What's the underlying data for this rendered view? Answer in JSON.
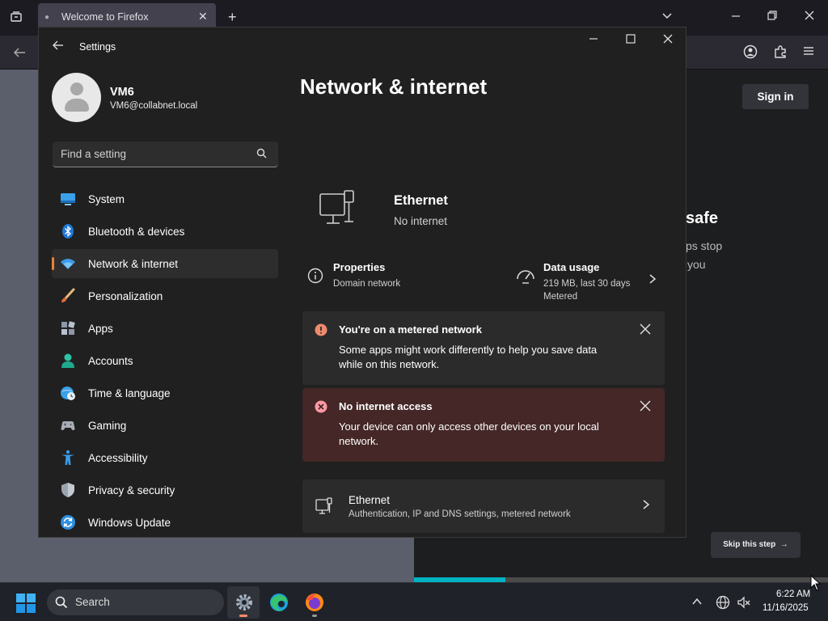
{
  "firefox": {
    "tab_title": "Welcome to Firefox",
    "signin_label": "Sign in",
    "heading_partial": "safe",
    "text_line1_partial": "ps stop",
    "text_line2_partial": "you",
    "skip_label": "Skip this step",
    "progress_fraction": 0.22
  },
  "settings": {
    "window_title": "Settings",
    "user": {
      "name": "VM6",
      "email": "VM6@collabnet.local"
    },
    "search_placeholder": "Find a setting",
    "nav": [
      {
        "label": "System",
        "icon": "system-icon",
        "active": false
      },
      {
        "label": "Bluetooth & devices",
        "icon": "bluetooth-icon",
        "active": false
      },
      {
        "label": "Network & internet",
        "icon": "wifi-icon",
        "active": true
      },
      {
        "label": "Personalization",
        "icon": "brush-icon",
        "active": false
      },
      {
        "label": "Apps",
        "icon": "apps-icon",
        "active": false
      },
      {
        "label": "Accounts",
        "icon": "accounts-icon",
        "active": false
      },
      {
        "label": "Time & language",
        "icon": "globe-clock-icon",
        "active": false
      },
      {
        "label": "Gaming",
        "icon": "gamepad-icon",
        "active": false
      },
      {
        "label": "Accessibility",
        "icon": "accessibility-icon",
        "active": false
      },
      {
        "label": "Privacy & security",
        "icon": "shield-icon",
        "active": false
      },
      {
        "label": "Windows Update",
        "icon": "update-icon",
        "active": false
      }
    ],
    "page_title": "Network & internet",
    "ethernet": {
      "title": "Ethernet",
      "status": "No internet"
    },
    "properties": {
      "title": "Properties",
      "subtitle": "Domain network"
    },
    "data_usage": {
      "title": "Data usage",
      "line1": "219 MB, last 30 days",
      "line2": "Metered"
    },
    "banner_metered": {
      "title": "You're on a metered network",
      "text": "Some apps might work differently to help you save data while on this network."
    },
    "banner_no_internet": {
      "title": "No internet access",
      "text": "Your device can only access other devices on your local network."
    },
    "ethernet_card": {
      "title": "Ethernet",
      "subtitle": "Authentication, IP and DNS settings, metered network"
    }
  },
  "taskbar": {
    "search_label": "Search",
    "time": "6:22 AM",
    "date": "11/16/2025"
  },
  "colors": {
    "accent": "#e8833a",
    "settings_bg": "#202020",
    "error_banner": "#442726",
    "progress": "#00b3c3"
  }
}
